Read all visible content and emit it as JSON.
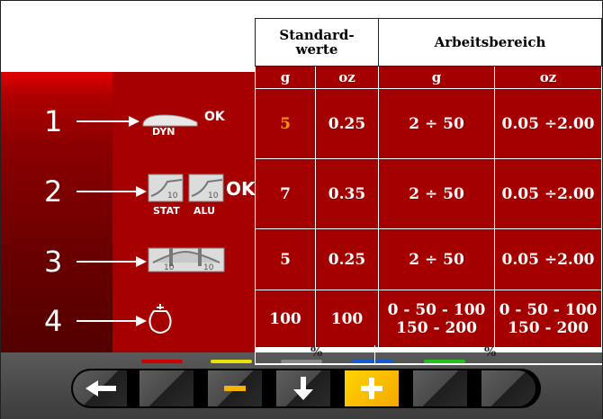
{
  "table": {
    "header_left": "Standard-\nwerte",
    "header_right": "Arbeitsbereich",
    "sub_headers": [
      "g",
      "oz",
      "g",
      "oz"
    ],
    "rows": [
      {
        "num": "1",
        "std_g": "5",
        "std_oz": "0.25",
        "range_g": "2 ÷ 50",
        "range_oz": "0.05 ÷2.00",
        "icon_label": "DYN",
        "ok": "OK"
      },
      {
        "num": "2",
        "std_g": "7",
        "std_oz": "0.35",
        "range_g": "2 ÷ 50",
        "range_oz": "0.05 ÷2.00",
        "icon_label_a": "STAT",
        "icon_label_b": "ALU",
        "ok": "OK"
      },
      {
        "num": "3",
        "std_g": "5",
        "std_oz": "0.25",
        "range_g": "2 ÷ 50",
        "range_oz": "0.05 ÷2.00"
      },
      {
        "num": "4",
        "std_g": "100",
        "std_oz": "100",
        "range_g_line1": "0 - 50 - 100",
        "range_g_line2": "150 - 200",
        "range_oz_line1": "0 - 50 - 100",
        "range_oz_line2": "150 - 200"
      }
    ],
    "percent_left": "%",
    "percent_right": "%",
    "icon_digits": [
      "10",
      "10",
      "10",
      "10"
    ]
  },
  "colors": {
    "panel_red": "#a50000",
    "highlight": "#ff9900",
    "indicators": [
      "#d00000",
      "#e8e000",
      "#888888",
      "#1a5ad0",
      "#22c020"
    ]
  },
  "toolbar": {
    "buttons": [
      "back-arrow-icon",
      "blank",
      "minus-icon",
      "down-arrow-icon",
      "plus-icon",
      "blank",
      "blank"
    ]
  }
}
